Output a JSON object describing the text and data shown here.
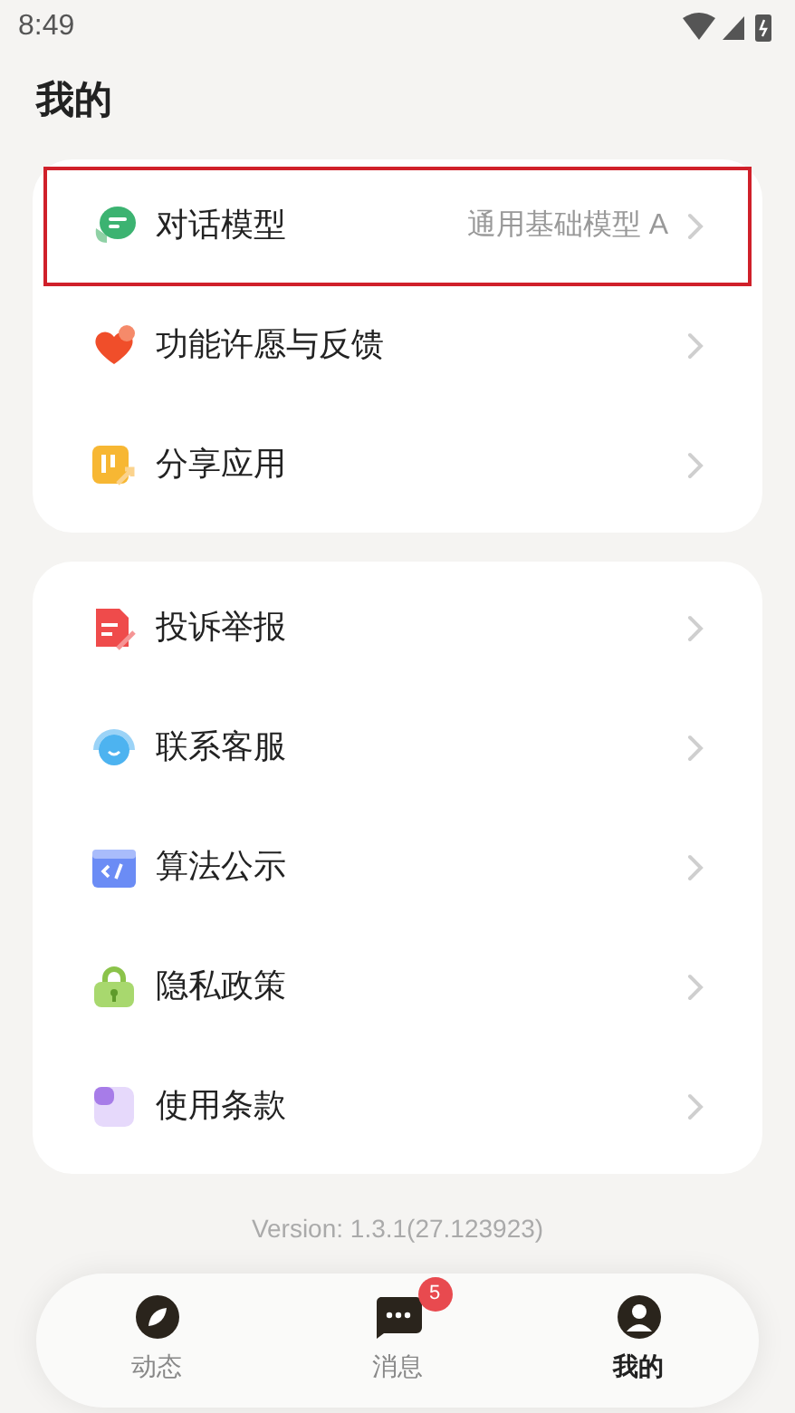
{
  "status_bar": {
    "time": "8:49"
  },
  "title": "我的",
  "sections": [
    {
      "items": [
        {
          "label": "对话模型",
          "value": "通用基础模型 A",
          "highlighted": true
        },
        {
          "label": "功能许愿与反馈",
          "highlighted": false
        },
        {
          "label": "分享应用",
          "highlighted": false
        }
      ]
    },
    {
      "items": [
        {
          "label": "投诉举报",
          "highlighted": false
        },
        {
          "label": "联系客服",
          "highlighted": false
        },
        {
          "label": "算法公示",
          "highlighted": false
        },
        {
          "label": "隐私政策",
          "highlighted": false
        },
        {
          "label": "使用条款",
          "highlighted": false
        }
      ]
    }
  ],
  "version": "Version: 1.3.1(27.123923)",
  "tab_bar": [
    {
      "label": "动态",
      "selected": false
    },
    {
      "label": "消息",
      "selected": false,
      "badge": "5"
    },
    {
      "label": "我的",
      "selected": true
    }
  ]
}
